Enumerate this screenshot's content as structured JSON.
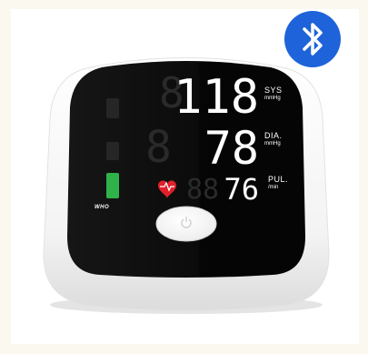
{
  "device": {
    "readings": {
      "sys": {
        "value": "118",
        "label": "SYS",
        "unit": "mmHg"
      },
      "dia": {
        "value": "78",
        "label": "DIA.",
        "unit": "mmHg"
      },
      "pul": {
        "value": "76",
        "label": "PUL.",
        "unit": "/min"
      }
    },
    "who_label": "WHO",
    "who_level": 1,
    "icons": [
      "bluetooth-icon",
      "heart-pulse-icon",
      "power-icon"
    ],
    "colors": {
      "bluetooth": "#1e63d9",
      "display": "#0a0a0a",
      "digits": "#ffffff",
      "heart": "#e0202a",
      "who_green": "#2fb24a",
      "body": "#f2f2f2"
    }
  }
}
